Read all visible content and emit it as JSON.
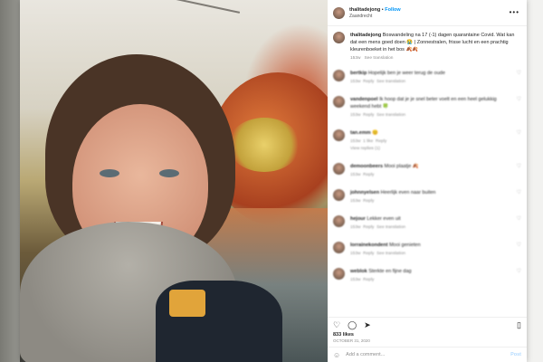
{
  "post": {
    "username": "thalitadejong",
    "follow_label": "Follow",
    "location": "Zaandrecht",
    "caption": {
      "username": "thalitadejong",
      "text": "Boswandeling na 17 (-1) dagen quarantaine Covid. Wat kan dat een mens goed doen 😭 | Zonnestralen, frisse lucht en een prachtig kleurenboeket in het bos 🍂🍂",
      "time": "153w",
      "translation": "See translation"
    },
    "comments": [
      {
        "username": "bertkip",
        "text": "Hopelijk ben je weer terug de oude",
        "time": "153w",
        "reply": "Reply",
        "translation": "See translation"
      },
      {
        "username": "vandenpoel",
        "text": "Ik hoop dat je je snel beter voelt en een heel gelukkig weekend hebt 🍀",
        "time": "153w",
        "reply": "Reply",
        "translation": "See translation"
      },
      {
        "username": "tan.emm",
        "text": "😊",
        "time": "153w",
        "reply": "1 like",
        "translation": "Reply",
        "replies": "View replies (1)"
      },
      {
        "username": "demoonbeers",
        "text": "Mooi plaatje 🍂",
        "time": "153w",
        "reply": "Reply"
      },
      {
        "username": "johnnyelsen",
        "text": "Heerlijk even naar buiten",
        "time": "153w",
        "reply": "Reply"
      },
      {
        "username": "hejour",
        "text": "Lekker even uit",
        "time": "153w",
        "reply": "Reply",
        "translation": "See translation"
      },
      {
        "username": "lorrainekondent",
        "text": "Mooi genieten",
        "time": "153w",
        "reply": "Reply",
        "translation": "See translation"
      },
      {
        "username": "weblok",
        "text": "Sterkte en fijne dag",
        "time": "153w",
        "reply": "Reply"
      }
    ],
    "likes": "833 likes",
    "date": "OCTOBER 31, 2020",
    "add_comment_placeholder": "Add a comment...",
    "post_button": "Post",
    "more_icon": "more-horizontal-icon"
  }
}
